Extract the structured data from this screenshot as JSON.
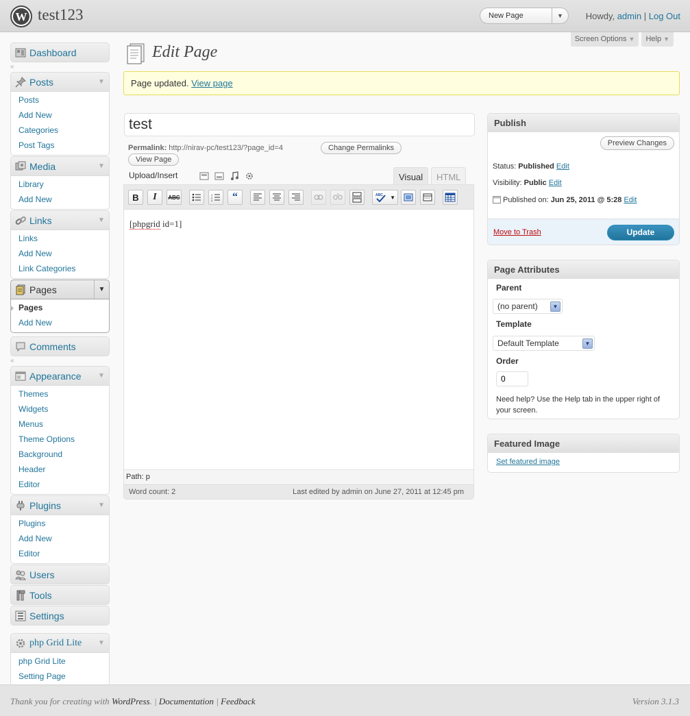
{
  "header": {
    "site_title": "test123",
    "favorite_action": "New Page",
    "howdy": "Howdy, ",
    "username": "admin",
    "separator": " | ",
    "logout": "Log Out"
  },
  "screen_meta": {
    "screen_options": "Screen Options",
    "help": "Help"
  },
  "menu": {
    "dashboard": "Dashboard",
    "posts": {
      "label": "Posts",
      "items": [
        "Posts",
        "Add New",
        "Categories",
        "Post Tags"
      ]
    },
    "media": {
      "label": "Media",
      "items": [
        "Library",
        "Add New"
      ]
    },
    "links": {
      "label": "Links",
      "items": [
        "Links",
        "Add New",
        "Link Categories"
      ]
    },
    "pages": {
      "label": "Pages",
      "items": [
        "Pages",
        "Add New"
      ]
    },
    "comments": "Comments",
    "appearance": {
      "label": "Appearance",
      "items": [
        "Themes",
        "Widgets",
        "Menus",
        "Theme Options",
        "Background",
        "Header",
        "Editor"
      ]
    },
    "plugins": {
      "label": "Plugins",
      "items": [
        "Plugins",
        "Add New",
        "Editor"
      ]
    },
    "users": "Users",
    "tools": "Tools",
    "settings": "Settings",
    "phpgrid": {
      "label": "php Grid Lite",
      "items": [
        "php Grid Lite",
        "Setting Page"
      ]
    }
  },
  "content": {
    "page_title": "Edit Page",
    "notice_text": "Page updated. ",
    "notice_link": "View page",
    "post_title": "test",
    "permalink_label": "Permalink:",
    "permalink_url": " http://nirav-pc/test123/?page_id=4",
    "change_permalinks": "Change Permalinks",
    "view_page": "View Page",
    "upload_insert": "Upload/Insert",
    "tab_visual": "Visual",
    "tab_html": "HTML",
    "editor_spell_word": "[phpgrid",
    "editor_rest": " id=1]",
    "path": "Path: p",
    "word_count": "Word count: 2",
    "last_edited": "Last edited by admin on June 27, 2011 at 12:45 pm"
  },
  "publish": {
    "title": "Publish",
    "preview": "Preview Changes",
    "status_label": "Status: ",
    "status_value": "Published",
    "visibility_label": "Visibility: ",
    "visibility_value": "Public",
    "published_label": "Published on: ",
    "published_value": "Jun 25, 2011 @ 5:28",
    "edit": "Edit",
    "trash": "Move to Trash",
    "update": "Update"
  },
  "attributes": {
    "title": "Page Attributes",
    "parent_label": "Parent",
    "parent_value": "(no parent)",
    "template_label": "Template",
    "template_value": "Default Template",
    "order_label": "Order",
    "order_value": "0",
    "help": "Need help? Use the Help tab in the upper right of your screen."
  },
  "featured": {
    "title": "Featured Image",
    "link": "Set featured image"
  },
  "footer": {
    "thanks": "Thank you for creating with ",
    "wordpress": "WordPress",
    "period": ".",
    "sep": " | ",
    "documentation": "Documentation",
    "feedback": "Feedback",
    "version": "Version 3.1.3"
  },
  "colors": {
    "link": "#21759b",
    "notice_bg": "#ffffe0",
    "notice_border": "#e6db55",
    "update_button": "#21759b",
    "trash": "#bc0b0b"
  },
  "icons": {
    "logo": "wordpress-logo-icon",
    "editor_toolbar": [
      "bold",
      "italic",
      "strikethrough",
      "bullet-list",
      "numbered-list",
      "blockquote",
      "align-left",
      "align-center",
      "align-right",
      "link",
      "unlink",
      "more-tag",
      "spellcheck",
      "fullscreen",
      "kitchen-sink",
      "grid"
    ]
  }
}
